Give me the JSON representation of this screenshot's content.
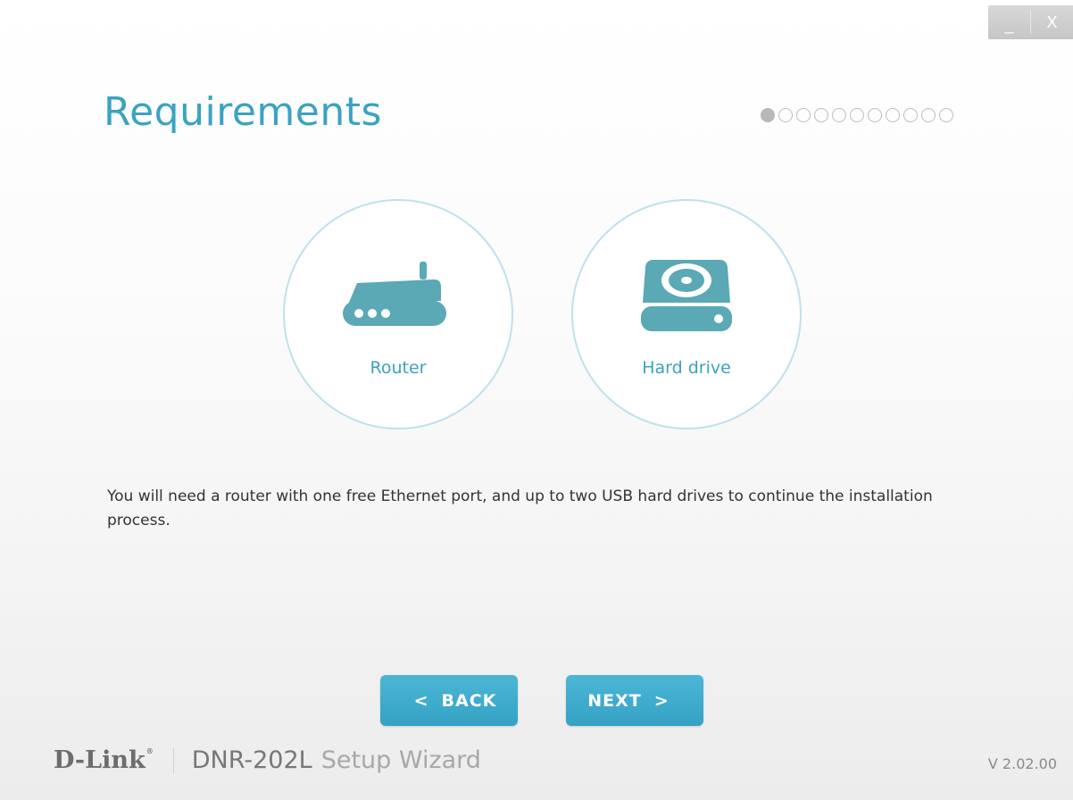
{
  "window": {
    "minimize_label": "_",
    "close_label": "X"
  },
  "page": {
    "title": "Requirements",
    "step_current": 1,
    "step_total": 11
  },
  "requirements": [
    {
      "label": "Router",
      "icon": "router-icon"
    },
    {
      "label": "Hard drive",
      "icon": "hard-drive-icon"
    }
  ],
  "description": "You will need a router with one free Ethernet port, and up to two USB hard drives to continue the installation process.",
  "buttons": {
    "back_chevron": "<",
    "back_label": "BACK",
    "next_label": "NEXT",
    "next_chevron": ">"
  },
  "footer": {
    "brand": "D-Link",
    "trademark": "®",
    "model": "DNR-202L",
    "product": "Setup Wizard",
    "version": "V 2.02.00"
  },
  "colors": {
    "accent": "#3aa3c1",
    "button": "#3ea9ca",
    "icon": "#5aa9b4",
    "circle_border": "#bfe1ea"
  }
}
